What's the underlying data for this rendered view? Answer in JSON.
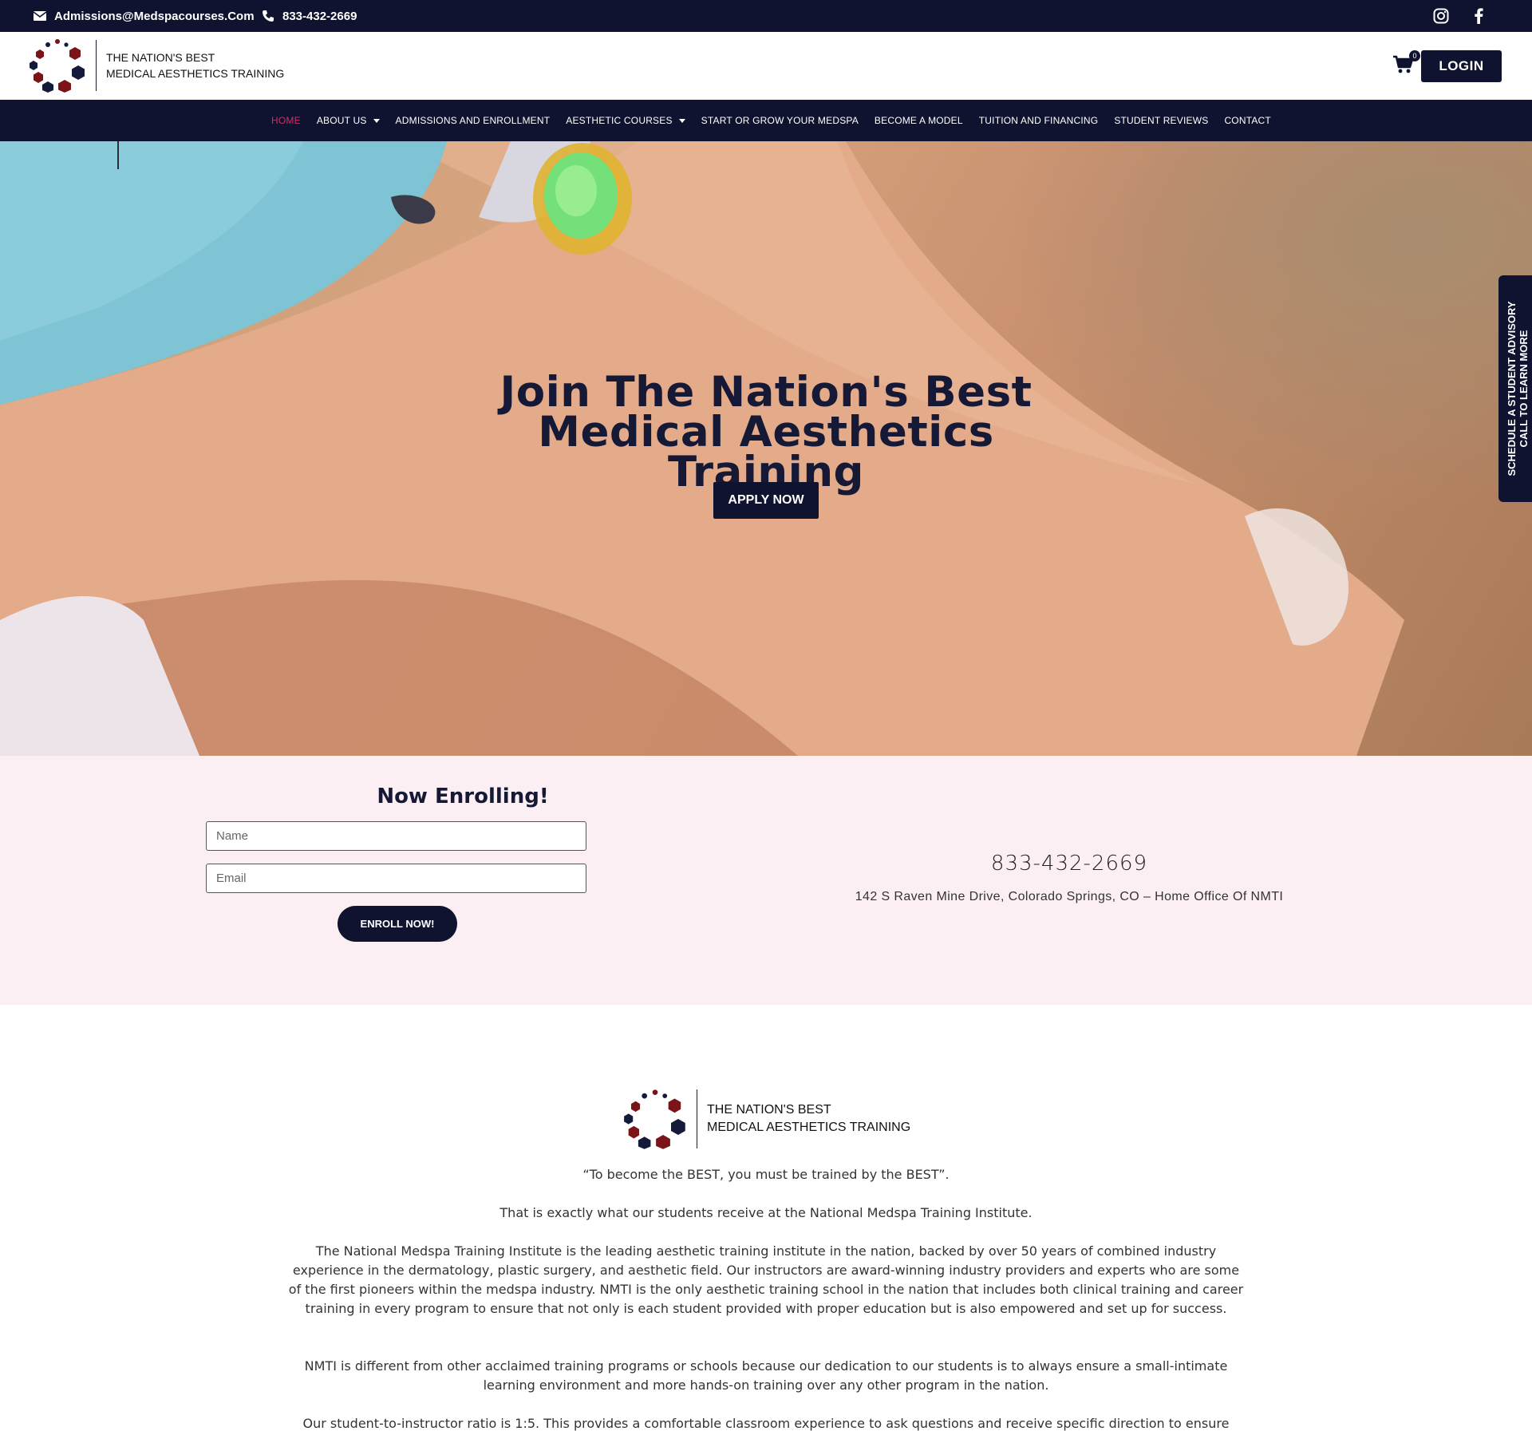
{
  "topbar": {
    "email": "Admissions@Medspacourses.Com",
    "phone": "833-432-2669",
    "social": [
      "instagram-icon",
      "facebook-icon"
    ]
  },
  "header": {
    "tagline_line1": "THE NATION'S BEST",
    "tagline_line2": "MEDICAL AESTHETICS TRAINING",
    "cart_count": "0",
    "login_label": "LOGIN"
  },
  "nav": {
    "items": [
      {
        "label": "HOME",
        "active": true
      },
      {
        "label": "ABOUT US",
        "dropdown": true
      },
      {
        "label": "ADMISSIONS AND ENROLLMENT"
      },
      {
        "label": "AESTHETIC COURSES",
        "dropdown": true
      },
      {
        "label": "START OR GROW YOUR MEDSPA"
      },
      {
        "label": "BECOME A MODEL"
      },
      {
        "label": "TUITION AND FINANCING"
      },
      {
        "label": "STUDENT REVIEWS"
      },
      {
        "label": "CONTACT"
      }
    ]
  },
  "hero": {
    "title_line1": "Join The Nation's Best",
    "title_line2": "Medical Aesthetics Training",
    "apply_label": "APPLY NOW",
    "side_tab_line1": "SCHEDULE A STUDENT ADVISORY",
    "side_tab_line2": "CALL TO LEARN MORE"
  },
  "enroll": {
    "heading": "Now Enrolling!",
    "name_placeholder": "Name",
    "email_placeholder": "Email",
    "button_label": "ENROLL NOW!",
    "phone": "833-432-2669",
    "address": "142 S Raven Mine Drive, Colorado Springs, CO – Home Office Of NMTI"
  },
  "about": {
    "tagline_line1": "THE NATION'S BEST",
    "tagline_line2": "MEDICAL AESTHETICS TRAINING",
    "quote": "“To become the BEST, you must be trained by the BEST”.",
    "p1": "That is exactly what our students receive at the National Medspa Training Institute.",
    "p2": "The National Medspa Training Institute is the leading aesthetic training institute in the nation, backed by over 50 years of combined industry experience in the dermatology, plastic surgery, and aesthetic field. Our instructors are award-winning industry providers and experts who are some of the first pioneers within the medspa industry. NMTI is the only aesthetic training school in the nation that includes both clinical training and career training in every program to ensure that not only is each student provided with proper education but is also empowered and set up for success.",
    "p3": "NMTI is different from other acclaimed training programs or schools because our dedication to our students is to always ensure a small-intimate learning environment and more hands-on training over any other program in the nation.",
    "p4": "Our student-to-instructor ratio is 1:5. This provides a comfortable classroom experience to ask questions and receive specific direction to ensure"
  },
  "colors": {
    "navy": "#0f1330",
    "active_nav": "#c8306a",
    "enroll_bg": "#fbeff3",
    "logo_red": "#7a1418",
    "logo_navy": "#141a3a"
  }
}
